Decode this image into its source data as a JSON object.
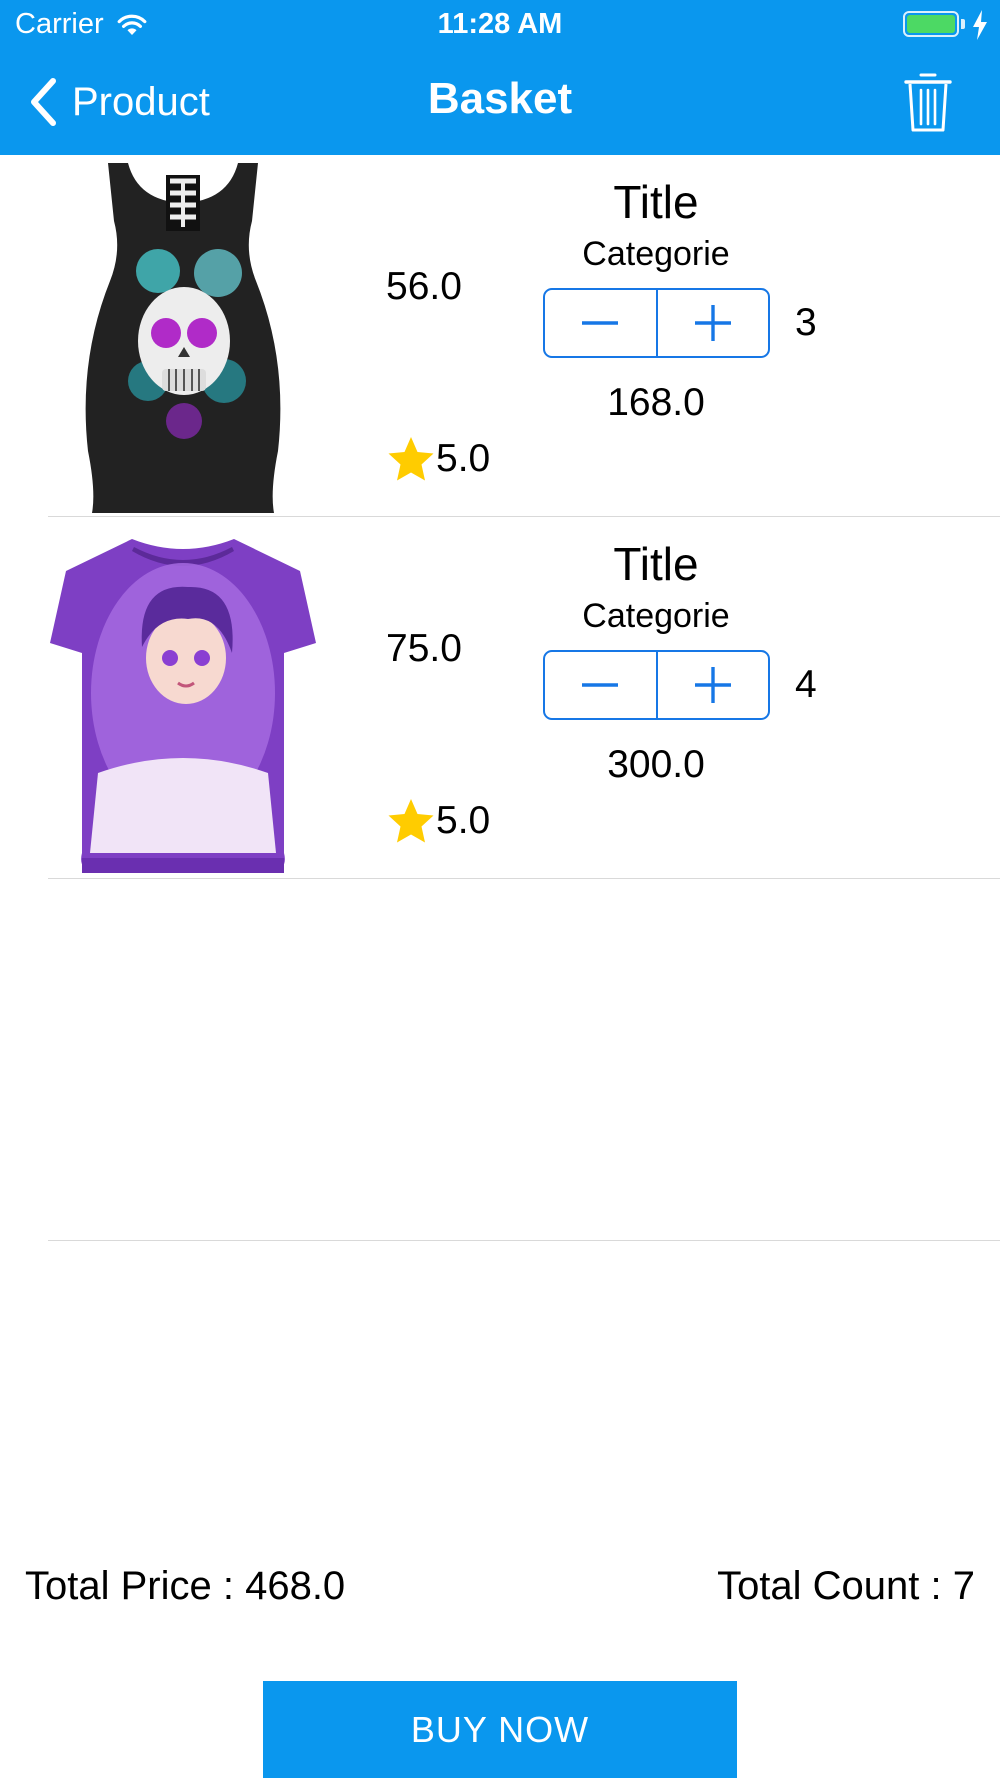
{
  "status_bar": {
    "carrier": "Carrier",
    "time": "11:28 AM",
    "wifi_icon": "wifi-icon",
    "battery_icon": "battery-charging-icon",
    "battery_color": "#4cd964"
  },
  "nav": {
    "back_label": "Product",
    "title": "Basket",
    "back_icon": "chevron-left-icon",
    "trash_icon": "trash-icon",
    "bar_color": "#0a97ee"
  },
  "items": [
    {
      "image": "skull-print-tank-top",
      "price": "56.0",
      "title": "Title",
      "categorie": "Categorie",
      "quantity": "3",
      "subtotal": "168.0",
      "rating": "5.0"
    },
    {
      "image": "purple-girl-print-tshirt",
      "price": "75.0",
      "title": "Title",
      "categorie": "Categorie",
      "quantity": "4",
      "subtotal": "300.0",
      "rating": "5.0"
    }
  ],
  "totals": {
    "price_label": "Total Price : 468.0",
    "count_label": "Total Count : 7"
  },
  "buy_button": {
    "label": "BUY NOW",
    "color": "#0a97ee"
  },
  "accent_color": "#1677e6",
  "star_color": "#ffcc00"
}
